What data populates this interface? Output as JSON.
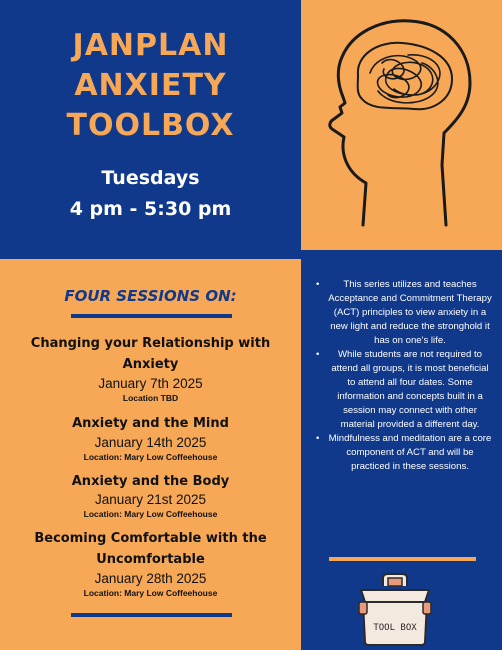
{
  "title": {
    "line1": "JANPLAN",
    "line2": "ANXIETY",
    "line3": "TOOLBOX"
  },
  "schedule": {
    "day": "Tuesdays",
    "time": "4 pm - 5:30 pm"
  },
  "sessions_heading": "FOUR SESSIONS ON:",
  "sessions": [
    {
      "title_line1": "Changing your Relationship with",
      "title_line2": "Anxiety",
      "date": "January 7th 2025",
      "location": "Location TBD"
    },
    {
      "title_line1": "Anxiety and the Mind",
      "date": "January 14th 2025",
      "location": "Location: Mary Low Coffeehouse"
    },
    {
      "title_line1": "Anxiety and the Body",
      "date": "January 21st 2025",
      "location": "Location: Mary Low Coffeehouse"
    },
    {
      "title_line1": "Becoming Comfortable with the",
      "title_line2": "Uncomfortable",
      "date": "January 28th 2025",
      "location": "Location: Mary Low Coffeehouse"
    }
  ],
  "bullets": [
    "This series utilizes and teaches Acceptance and Commitment Therapy (ACT) principles to view anxiety in a new light and reduce the stronghold it has on one's life.",
    "While students are not required to attend all groups, it is most beneficial to attend all four dates. Some information and concepts built in a session may connect with other material provided a different day.",
    "Mindfulness and meditation are a core component of ACT and will be practiced in these sessions."
  ],
  "toolbox_label": "TOOL BOX",
  "colors": {
    "navy": "#10398c",
    "orange": "#f7a857"
  },
  "icons": [
    "head-with-tangled-thoughts-icon",
    "toolbox-icon"
  ]
}
